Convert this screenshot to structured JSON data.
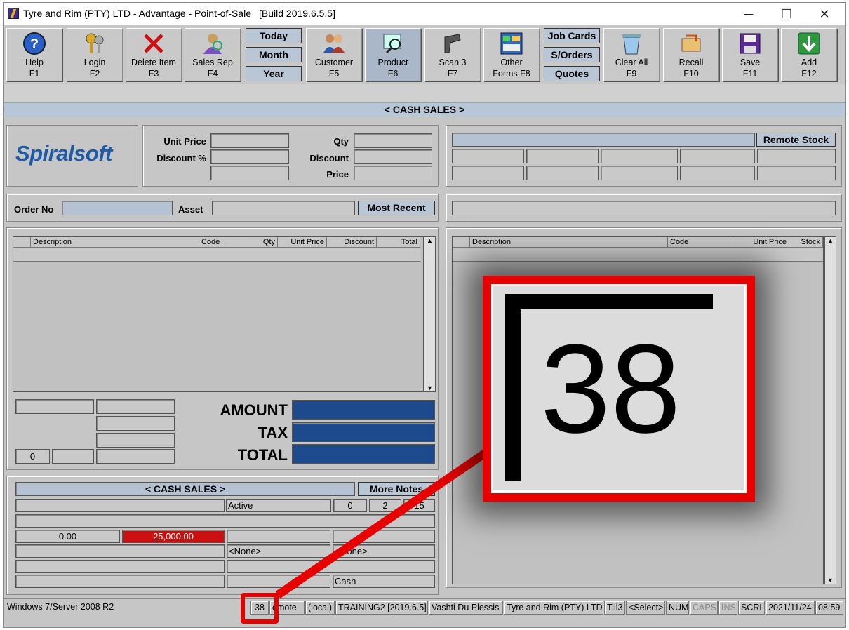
{
  "window": {
    "title": "Tyre and Rim (PTY) LTD - Advantage - Point-of-Sale",
    "build": "[Build 2019.6.5.5]",
    "minimize": "─",
    "maximize": "☐",
    "close": "✕"
  },
  "toolbar": {
    "help": {
      "label": "Help",
      "key": "F1"
    },
    "login": {
      "label": "Login",
      "key": "F2"
    },
    "delete": {
      "label": "Delete Item",
      "key": "F3"
    },
    "salesrep": {
      "label": "Sales Rep",
      "key": "F4"
    },
    "today": "Today",
    "month": "Month",
    "year": "Year",
    "customer": {
      "label": "Customer",
      "key": "F5"
    },
    "product": {
      "label": "Product",
      "key": "F6"
    },
    "scan": {
      "label": "Scan 3",
      "key": "F7"
    },
    "other": {
      "label": "Other",
      "key": "Forms F8"
    },
    "jobcards": "Job Cards",
    "sorders": "S/Orders",
    "quotes": "Quotes",
    "clearall": {
      "label": "Clear All",
      "key": "F9"
    },
    "recall": {
      "label": "Recall",
      "key": "F10"
    },
    "save": {
      "label": "Save",
      "key": "F11"
    },
    "add": {
      "label": "Add",
      "key": "F12"
    }
  },
  "header": {
    "band": "< CASH SALES >"
  },
  "logo": {
    "text": "Spiralsoft"
  },
  "pricing": {
    "unit_price": "Unit Price",
    "discount_pct": "Discount %",
    "qty": "Qty",
    "discount": "Discount",
    "price": "Price"
  },
  "order": {
    "order_no": "Order No",
    "asset": "Asset",
    "most_recent": "Most Recent"
  },
  "remote_stock": "Remote Stock",
  "grid_left": {
    "cols": [
      "Description",
      "Code",
      "Qty",
      "Unit Price",
      "Discount",
      "Total"
    ]
  },
  "grid_right": {
    "cols": [
      "Description",
      "Code",
      "Unit Price",
      "Stock"
    ]
  },
  "totals": {
    "amount": "AMOUNT",
    "tax": "TAX",
    "total": "TOTAL",
    "count": "0"
  },
  "bottom": {
    "band": "< CASH SALES >",
    "more_notes": "More Notes",
    "status": "Active",
    "n1": "0",
    "n2": "2",
    "n3": "15",
    "balance": "0.00",
    "limit": "25,000.00",
    "none1": "<None>",
    "none2": "None>",
    "payment": "Cash"
  },
  "zoom": {
    "value": "38"
  },
  "statusbar": {
    "os": "Windows 7/Server 2008 R2",
    "num": "38",
    "remote": "emote",
    "local": "(local)",
    "db": "TRAINING2 [2019.6.5]",
    "user": "Vashti Du Plessis",
    "company": "Tyre and Rim (PTY) LTD",
    "till": "Till3",
    "select": "<Select>",
    "numlock": "NUM",
    "caps": "CAPS",
    "ins": "INS",
    "scrl": "SCRL",
    "date": "2021/11/24",
    "time": "08:59"
  },
  "colors": {
    "highlight": "#e60000",
    "amount_field": "#1c4a8c",
    "limit_field": "#cc1010"
  }
}
